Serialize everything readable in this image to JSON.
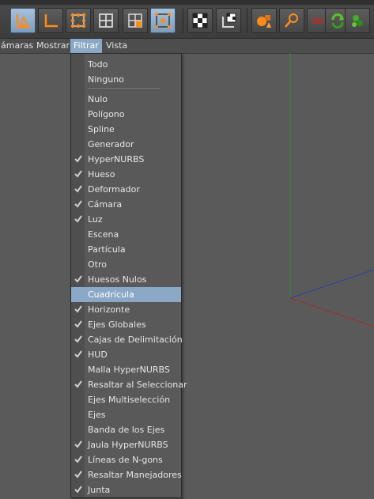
{
  "menubar": {
    "items": [
      {
        "label": "ámaras",
        "active": false
      },
      {
        "label": "Mostrar",
        "active": false
      },
      {
        "label": "Filtrar",
        "active": true
      },
      {
        "label": "Vista",
        "active": false
      }
    ]
  },
  "filter_menu": {
    "top_items": [
      {
        "label": "Todo"
      },
      {
        "label": "Ninguno"
      }
    ],
    "items": [
      {
        "label": "Nulo",
        "checked": false
      },
      {
        "label": "Polígono",
        "checked": false
      },
      {
        "label": "Spline",
        "checked": false
      },
      {
        "label": "Generador",
        "checked": false
      },
      {
        "label": "HyperNURBS",
        "checked": true
      },
      {
        "label": "Hueso",
        "checked": true
      },
      {
        "label": "Deformador",
        "checked": true
      },
      {
        "label": "Cámara",
        "checked": true
      },
      {
        "label": "Luz",
        "checked": true
      },
      {
        "label": "Escena",
        "checked": false
      },
      {
        "label": "Partícula",
        "checked": false
      },
      {
        "label": "Otro",
        "checked": false
      },
      {
        "label": "Huesos Nulos",
        "checked": true
      },
      {
        "label": "Cuadrícula",
        "checked": false,
        "highlighted": true
      },
      {
        "label": "Horizonte",
        "checked": true
      },
      {
        "label": "Ejes Globales",
        "checked": true
      },
      {
        "label": "Cajas de Delimitación",
        "checked": true
      },
      {
        "label": "HUD",
        "checked": true
      },
      {
        "label": "Malla HyperNURBS",
        "checked": false
      },
      {
        "label": "Resaltar al Seleccionar",
        "checked": true
      },
      {
        "label": "Ejes Multiselección",
        "checked": false
      },
      {
        "label": "Ejes",
        "checked": false
      },
      {
        "label": "Banda de los Ejes",
        "checked": false
      },
      {
        "label": "Jaula HyperNURBS",
        "checked": true
      },
      {
        "label": "Líneas de N-gons",
        "checked": true
      },
      {
        "label": "Resaltar Manejadores",
        "checked": true
      },
      {
        "label": "Junta",
        "checked": true
      }
    ]
  },
  "colors": {
    "highlight": "#8ba8c6",
    "axis_green": "#2f8a3a",
    "axis_blue": "#2b3fa8",
    "axis_red": "#a82b2b",
    "ok_red": "#d42020"
  },
  "toolbar_icons": [
    "polygon-mode-icon",
    "axis-mode-icon",
    "points-mode-icon",
    "edges-mode-icon",
    "polygons-mode-icon",
    "object-mode-icon",
    "checker-texture-icon",
    "texture-axis-icon",
    "primitive-shapes-icon",
    "magnifier-icon",
    "ok-icon",
    "refresh-green-icon",
    "plugin-green-icon"
  ]
}
